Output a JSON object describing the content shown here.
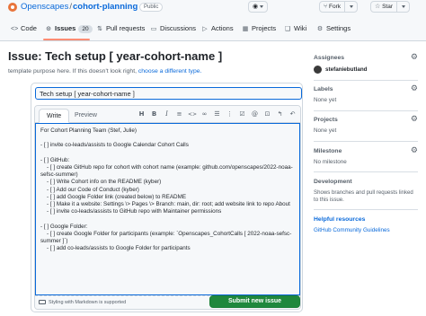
{
  "header": {
    "org": "Openscapes",
    "separator": "/",
    "repo": "cohort-planning",
    "visibility": "Public",
    "watch_label": "",
    "fork_label": "Fork",
    "star_label": "Star"
  },
  "tabs": [
    {
      "label": "Code",
      "icon": "code-icon"
    },
    {
      "label": "Issues",
      "icon": "issue-icon",
      "count": "20"
    },
    {
      "label": "Pull requests",
      "icon": "pull-request-icon"
    },
    {
      "label": "Discussions",
      "icon": "discussion-icon"
    },
    {
      "label": "Actions",
      "icon": "play-icon"
    },
    {
      "label": "Projects",
      "icon": "table-icon"
    },
    {
      "label": "Wiki",
      "icon": "book-icon"
    },
    {
      "label": "Settings",
      "icon": "gear-icon"
    }
  ],
  "page": {
    "title": "Issue: Tech setup [ year-cohort-name ]",
    "template_note": "template purpose here. If this doesn't look right,",
    "template_link": "choose a different type."
  },
  "editor": {
    "title_value": "Tech setup [ year-cohort-name ]",
    "write_tab": "Write",
    "preview_tab": "Preview",
    "body_lines": [
      "For Cohort Planning Team (Stef, Julie)",
      "",
      "- [ ] invite co-leads/assists to Google Calendar Cohort Calls",
      "",
      "- [ ] GitHub:",
      "    - [ ] create GitHub repo for cohort with cohort name (example: github.com/openscapes/2022-noaa-sefsc-summer)",
      "    - [ ] Write Cohort info on the README (kyber)",
      "    - [ ] Add our Code of Conduct (kyber)",
      "    - [ ] add Google Folder link (created below) to README",
      "    - [ ] Make it a website: Settings \\> Pages \\> Branch: main, dir: root; add website link to repo About",
      "    - [ ] invite co-leads/assists to GitHub repo with Maintainer permissions",
      "",
      "- [ ] Google Folder:",
      "    - [ ] create Google Folder for participants (example: `Openscapes_CohortCalls [ 2022-noaa-sefsc-summer ]`)",
      "    - [ ] add co-leads/assists to Google Folder for participants"
    ],
    "markdown_hint": "Styling with Markdown is supported",
    "submit_label": "Submit new issue",
    "toolbar_icons": [
      "heading-icon",
      "bold-icon",
      "italic-icon",
      "quote-icon",
      "code-icon",
      "link-icon",
      "unordered-list-icon",
      "ordered-list-icon",
      "task-list-icon",
      "mention-icon",
      "cross-reference-icon",
      "reply-icon",
      "undo-icon"
    ]
  },
  "sidebar": {
    "assignees_label": "Assignees",
    "assignee_name": "stefaniebutland",
    "labels_label": "Labels",
    "labels_value": "None yet",
    "projects_label": "Projects",
    "projects_value": "None yet",
    "milestone_label": "Milestone",
    "milestone_value": "No milestone",
    "development_label": "Development",
    "development_text": "Shows branches and pull requests linked to this issue.",
    "helpful_label": "Helpful resources",
    "helpful_link": "GitHub Community Guidelines"
  },
  "colors": {
    "link": "#0969da",
    "submit": "#1f883d",
    "tab_underline": "#fd8c73"
  }
}
